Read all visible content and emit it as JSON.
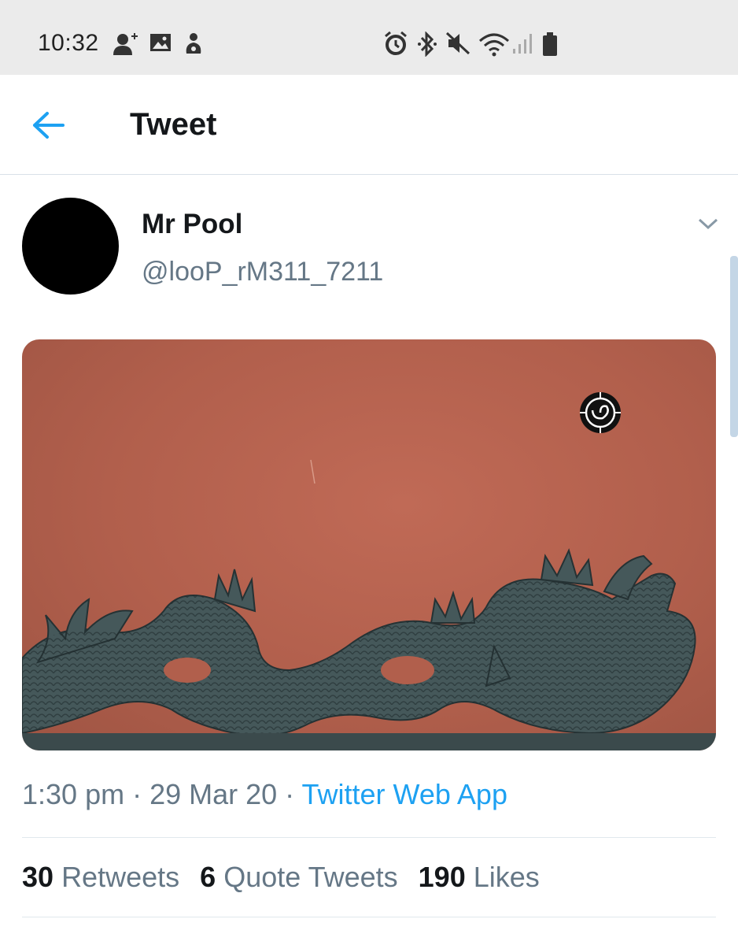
{
  "status_bar": {
    "time": "10:32"
  },
  "header": {
    "title": "Tweet"
  },
  "tweet": {
    "author_name": "Mr Pool",
    "author_handle": "@looP_rM311_7211",
    "time": "1:30 pm",
    "date": "29 Mar 20",
    "source": "Twitter Web App",
    "separator": " · "
  },
  "stats": {
    "retweets_count": "30",
    "retweets_label": "Retweets",
    "quote_count": "6",
    "quote_label": "Quote Tweets",
    "likes_count": "190",
    "likes_label": "Likes"
  },
  "colors": {
    "accent": "#1da1f2",
    "media_background": "#b15f4c",
    "status_bar": "#ebebeb"
  },
  "icons": [
    "add-person-icon",
    "image-icon",
    "notification-icon",
    "alarm-icon",
    "bluetooth-icon",
    "mute-icon",
    "wifi-icon",
    "signal-icon",
    "battery-icon",
    "back-arrow-icon",
    "chevron-down-icon"
  ]
}
